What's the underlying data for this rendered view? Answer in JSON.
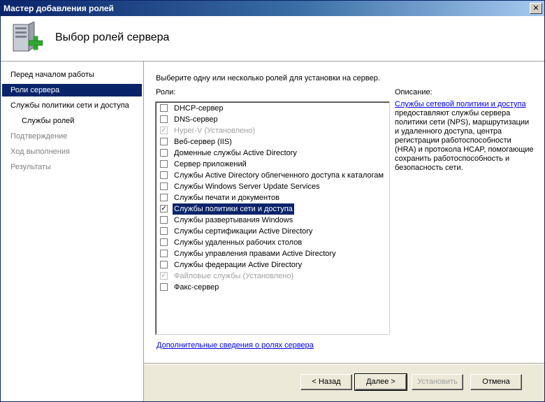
{
  "window": {
    "title": "Мастер добавления ролей",
    "close_label": "✕"
  },
  "header": {
    "title": "Выбор ролей сервера",
    "icon": "server-add-icon"
  },
  "nav": {
    "items": [
      {
        "label": "Перед началом работы",
        "state": "normal"
      },
      {
        "label": "Роли сервера",
        "state": "active"
      },
      {
        "label": "Службы политики сети и доступа",
        "state": "normal"
      },
      {
        "label": "Службы ролей",
        "state": "sub"
      },
      {
        "label": "Подтверждение",
        "state": "disabled"
      },
      {
        "label": "Ход выполнения",
        "state": "disabled"
      },
      {
        "label": "Результаты",
        "state": "disabled"
      }
    ]
  },
  "content": {
    "instruction": "Выберите одну или несколько ролей для установки на сервер.",
    "roles_label": "Роли:",
    "roles": [
      {
        "label": "DHCP-сервер",
        "checked": false,
        "disabled": false,
        "selected": false
      },
      {
        "label": "DNS-сервер",
        "checked": false,
        "disabled": false,
        "selected": false
      },
      {
        "label": "Hyper-V  (Установлено)",
        "checked": true,
        "disabled": true,
        "selected": false
      },
      {
        "label": "Веб-сервер (IIS)",
        "checked": false,
        "disabled": false,
        "selected": false
      },
      {
        "label": "Доменные службы Active Directory",
        "checked": false,
        "disabled": false,
        "selected": false
      },
      {
        "label": "Сервер приложений",
        "checked": false,
        "disabled": false,
        "selected": false
      },
      {
        "label": "Службы Active Directory облегченного доступа к каталогам",
        "checked": false,
        "disabled": false,
        "selected": false
      },
      {
        "label": "Службы Windows Server Update Services",
        "checked": false,
        "disabled": false,
        "selected": false
      },
      {
        "label": "Службы печати и документов",
        "checked": false,
        "disabled": false,
        "selected": false
      },
      {
        "label": "Службы политики сети и доступа",
        "checked": true,
        "disabled": false,
        "selected": true
      },
      {
        "label": "Службы развертывания Windows",
        "checked": false,
        "disabled": false,
        "selected": false
      },
      {
        "label": "Службы сертификации Active Directory",
        "checked": false,
        "disabled": false,
        "selected": false
      },
      {
        "label": "Службы удаленных рабочих столов",
        "checked": false,
        "disabled": false,
        "selected": false
      },
      {
        "label": "Службы управления правами Active Directory",
        "checked": false,
        "disabled": false,
        "selected": false
      },
      {
        "label": "Службы федерации Active Directory",
        "checked": false,
        "disabled": false,
        "selected": false
      },
      {
        "label": "Файловые службы  (Установлено)",
        "checked": true,
        "disabled": true,
        "selected": false
      },
      {
        "label": "Факс-сервер",
        "checked": false,
        "disabled": false,
        "selected": false
      }
    ],
    "description_label": "Описание:",
    "description_link": "Службы сетевой политики и доступа",
    "description_text": " предоставляют службы сервера политики сети (NPS), маршрутизации и удаленного доступа, центра регистрации работоспособности (HRA) и протокола HCAP, помогающие сохранить работоспособность и безопасность сети.",
    "more_link": "Дополнительные сведения о ролях сервера"
  },
  "buttons": {
    "back": "< Назад",
    "next": "Далее >",
    "install": "Установить",
    "cancel": "Отмена"
  },
  "colors": {
    "titlebar": "#0a246a",
    "selection": "#0a246a",
    "link": "#0000ee"
  }
}
